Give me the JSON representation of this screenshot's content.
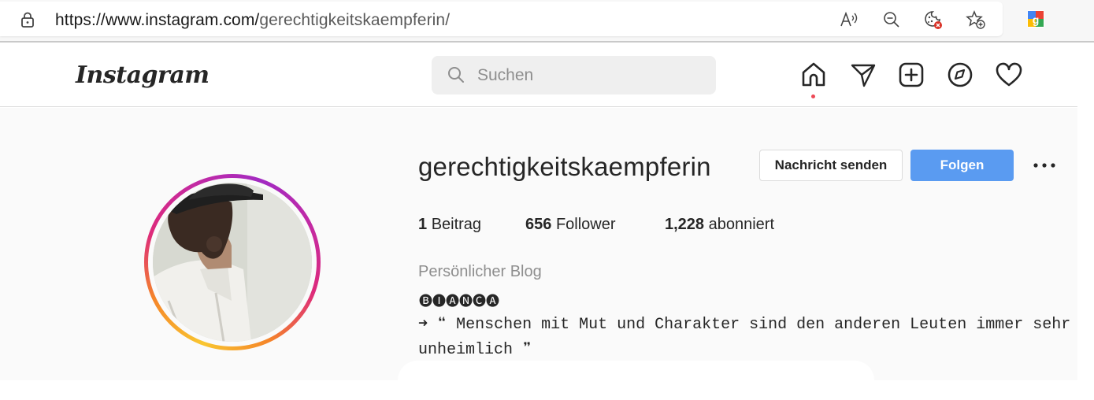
{
  "browser": {
    "url_host": "https://www.instagram.com/",
    "url_path": "gerechtigkeitskaempferin/",
    "icons": [
      "lock-icon",
      "read-aloud-icon",
      "zoom-out-icon",
      "cookie-blocked-icon",
      "favorite-add-icon",
      "google-extension-icon"
    ]
  },
  "header": {
    "logo_text": "Instagram",
    "search_placeholder": "Suchen",
    "nav_icons": [
      "home-icon",
      "direct-message-icon",
      "new-post-icon",
      "explore-icon",
      "activity-heart-icon"
    ]
  },
  "profile": {
    "username": "gerechtigkeitskaempferin",
    "message_button": "Nachricht senden",
    "follow_button": "Folgen",
    "stats": {
      "posts_count": "1",
      "posts_label": "Beitrag",
      "followers_count": "656",
      "followers_label": "Follower",
      "following_count": "1,228",
      "following_label": "abonniert"
    },
    "category": "Persönlicher Blog",
    "display_name": "🅑🅘🅐🅝🅒🅐",
    "bio_line1": "➜ ❝ Menschen mit Mut und Charakter sind den anderen Leuten immer sehr",
    "bio_line2": "unheimlich ❞"
  },
  "colors": {
    "follow_blue": "#5a9bf1",
    "notification_dot": "#ed4956",
    "profile_bg": "#fafafa"
  }
}
